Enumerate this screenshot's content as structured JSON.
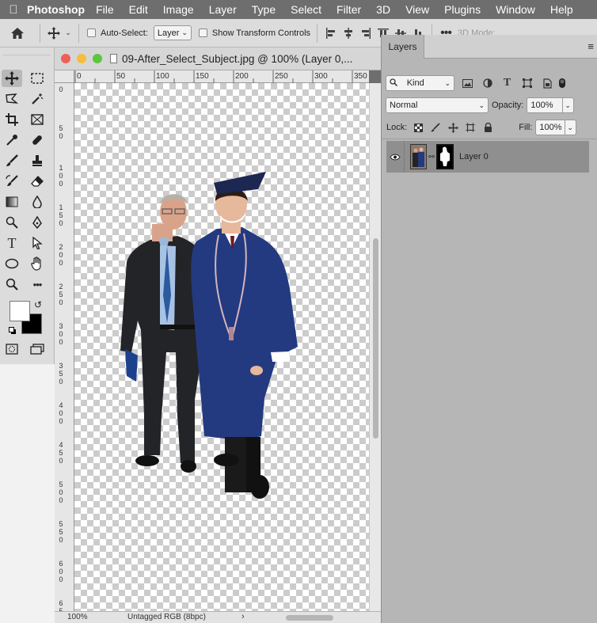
{
  "menubar": {
    "app": "Photoshop",
    "items": [
      "File",
      "Edit",
      "Image",
      "Layer",
      "Type",
      "Select",
      "Filter",
      "3D",
      "View",
      "Plugins",
      "Window",
      "Help"
    ]
  },
  "options": {
    "auto_select_label": "Auto-Select:",
    "auto_select_value": "Layer",
    "show_transform_label": "Show Transform Controls",
    "mode_3d_label": "3D Mode:"
  },
  "document": {
    "title": "09-After_Select_Subject.jpg @ 100% (Layer 0,...",
    "zoom": "100%",
    "color_profile": "Untagged RGB (8bpc)",
    "ruler_h": [
      "0",
      "50",
      "100",
      "150",
      "200",
      "250",
      "300",
      "350"
    ],
    "ruler_v": [
      "0",
      "5 0",
      "1 0 0",
      "1 5 0",
      "2 0 0",
      "2 5 0",
      "3 0 0",
      "3 5 0",
      "4 0 0",
      "4 5 0",
      "5 0 0",
      "5 5 0",
      "6 0 0",
      "6 5"
    ]
  },
  "layers_panel": {
    "tab": "Layers",
    "filter_kind": "Kind",
    "blend_mode": "Normal",
    "opacity_label": "Opacity:",
    "opacity": "100%",
    "lock_label": "Lock:",
    "fill_label": "Fill:",
    "fill": "100%",
    "layers": [
      {
        "name": "Layer 0",
        "visible": true
      }
    ]
  },
  "colors": {
    "foreground": "#ffffff",
    "background": "#000000",
    "gown": "#233a80",
    "suit": "#232427",
    "tie": "#2b5a9e"
  }
}
